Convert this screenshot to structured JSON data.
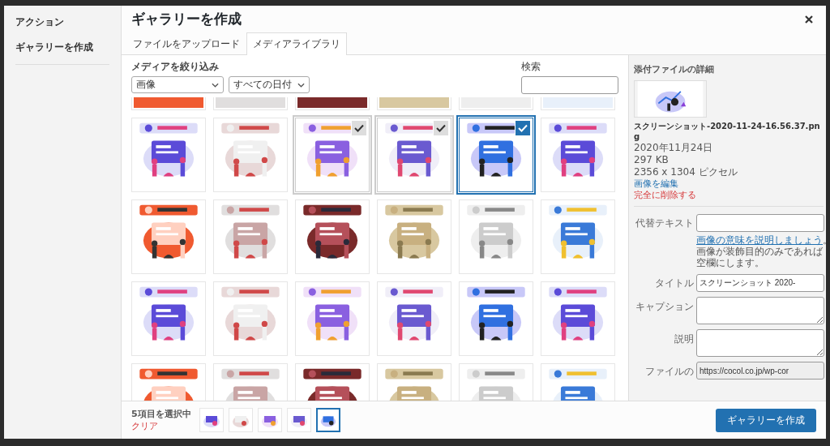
{
  "menu": {
    "heading": "アクション",
    "items": [
      {
        "label": "ギャラリーを作成",
        "selected": true
      }
    ]
  },
  "title": "ギャラリーを作成",
  "tabs": [
    {
      "label": "ファイルをアップロード",
      "selected": false
    },
    {
      "label": "メディアライブラリ",
      "selected": true
    }
  ],
  "filters": {
    "label": "メディアを絞り込み",
    "type": "画像",
    "date": "すべての日付"
  },
  "search": {
    "label": "検索"
  },
  "attachments": [
    {
      "kind": "picture",
      "selected": false,
      "current": false
    },
    {
      "kind": "picture",
      "selected": false,
      "current": false
    },
    {
      "kind": "picture",
      "selected": false,
      "current": false
    },
    {
      "kind": "picture",
      "selected": false,
      "current": false
    },
    {
      "kind": "picture",
      "selected": false,
      "current": false
    },
    {
      "kind": "picture",
      "selected": false,
      "current": false
    },
    {
      "kind": "picture",
      "selected": false,
      "current": false
    },
    {
      "kind": "picture",
      "selected": false,
      "current": false
    },
    {
      "kind": "picture",
      "selected": true,
      "current": false
    },
    {
      "kind": "picture",
      "selected": true,
      "current": false
    },
    {
      "kind": "picture",
      "selected": true,
      "current": true
    },
    {
      "kind": "picture",
      "selected": false,
      "current": false
    },
    {
      "kind": "picture",
      "selected": false,
      "current": false
    },
    {
      "kind": "picture",
      "selected": false,
      "current": false
    },
    {
      "kind": "picture",
      "selected": false,
      "current": false
    },
    {
      "kind": "picture",
      "selected": false,
      "current": false
    },
    {
      "kind": "picture",
      "selected": false,
      "current": false
    },
    {
      "kind": "picture",
      "selected": false,
      "current": false
    },
    {
      "kind": "picture",
      "selected": false,
      "current": false
    },
    {
      "kind": "picture",
      "selected": false,
      "current": false
    },
    {
      "kind": "picture",
      "selected": false,
      "current": false
    },
    {
      "kind": "picture",
      "selected": false,
      "current": false
    },
    {
      "kind": "picture",
      "selected": false,
      "current": false
    },
    {
      "kind": "picture",
      "selected": false,
      "current": false
    },
    {
      "kind": "picture",
      "selected": false,
      "current": false
    },
    {
      "kind": "picture",
      "selected": false,
      "current": false
    },
    {
      "kind": "picture",
      "selected": false,
      "current": false
    },
    {
      "kind": "picture",
      "selected": false,
      "current": false
    },
    {
      "kind": "picture",
      "selected": false,
      "current": false
    },
    {
      "kind": "picture",
      "selected": false,
      "current": false
    }
  ],
  "details": {
    "heading": "添付ファイルの詳細",
    "filename": "スクリーンショット-2020-11-24-16.56.37.png",
    "date": "2020年11月24日",
    "size": "297 KB",
    "dimensions": "2356 x 1304 ピクセル",
    "edit_link": "画像を編集",
    "delete_link": "完全に削除する",
    "fields": [
      {
        "kind": "input",
        "label": "代替テキスト",
        "link": "画像の意味を説明しましょう",
        "after_link": "。",
        "help": "画像が装飾目的のみであれば空欄にします。"
      },
      {
        "kind": "input",
        "label": "タイトル",
        "value": "スクリーンショット 2020-"
      },
      {
        "kind": "textarea",
        "label": "キャプション"
      },
      {
        "kind": "textarea",
        "label": "説明"
      },
      {
        "kind": "readonly",
        "label": "ファイルの",
        "value": "https://cocol.co.jp/wp-cor"
      }
    ]
  },
  "selection": {
    "count": "5項目を選択中",
    "clear": "クリア",
    "items": [
      {
        "kind": "picture",
        "current": false
      },
      {
        "kind": "picture",
        "current": false
      },
      {
        "kind": "picture",
        "current": false
      },
      {
        "kind": "picture",
        "current": false
      },
      {
        "kind": "picture",
        "current": true
      }
    ]
  },
  "primary_button": "ギャラリーを作成"
}
